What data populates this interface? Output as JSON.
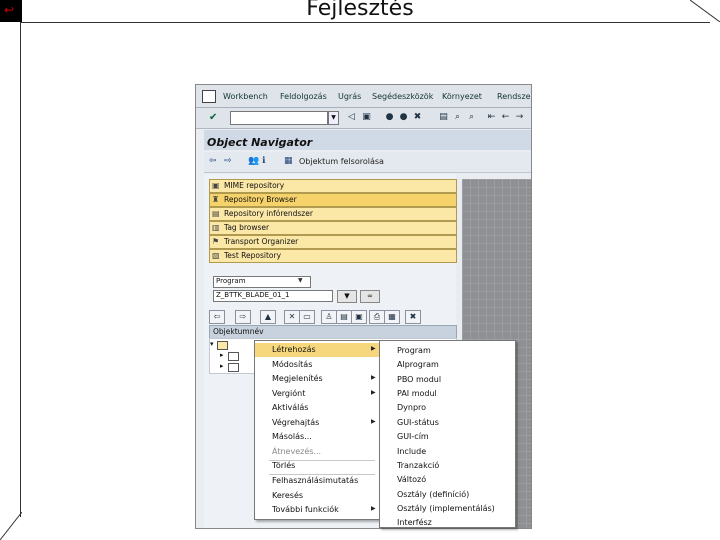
{
  "slide": {
    "title": "Fejlesztés"
  },
  "menubar": {
    "items": [
      "Workbench",
      "Feldolgozás",
      "Ugrás",
      "Segédeszközök",
      "Környezet",
      "Rendszer"
    ]
  },
  "navigator": {
    "title": "Object Navigator",
    "toolbar_label": "Objektum felsorolása"
  },
  "object_buttons": [
    "MIME repository",
    "Repository Browser",
    "Repository infórendszer",
    "Tag browser",
    "Transport Organizer",
    "Test Repository"
  ],
  "selection": {
    "type": "Program",
    "name": "Z_BTTK_BLADE_01_1"
  },
  "tree": {
    "header": "Objektumnév"
  },
  "context_menu": {
    "items": [
      "Létrehozás",
      "Módosítás",
      "Megjelenítés",
      "Vergiónt",
      "Aktiválás",
      "Végrehajtás",
      "Másolás...",
      "Átnevezés...",
      "Törlés",
      "Felhasználásimutatás",
      "Keresés",
      "További funkciók"
    ]
  },
  "submenu": {
    "items": [
      "Program",
      "Alprogram",
      "PBO modul",
      "PAI modul",
      "Dynpro",
      "GUI-státus",
      "GUI-cím",
      "Include",
      "Tranzakció",
      "Változó",
      "Osztály (definíció)",
      "Osztály (implementálás)",
      "Interfész"
    ]
  }
}
